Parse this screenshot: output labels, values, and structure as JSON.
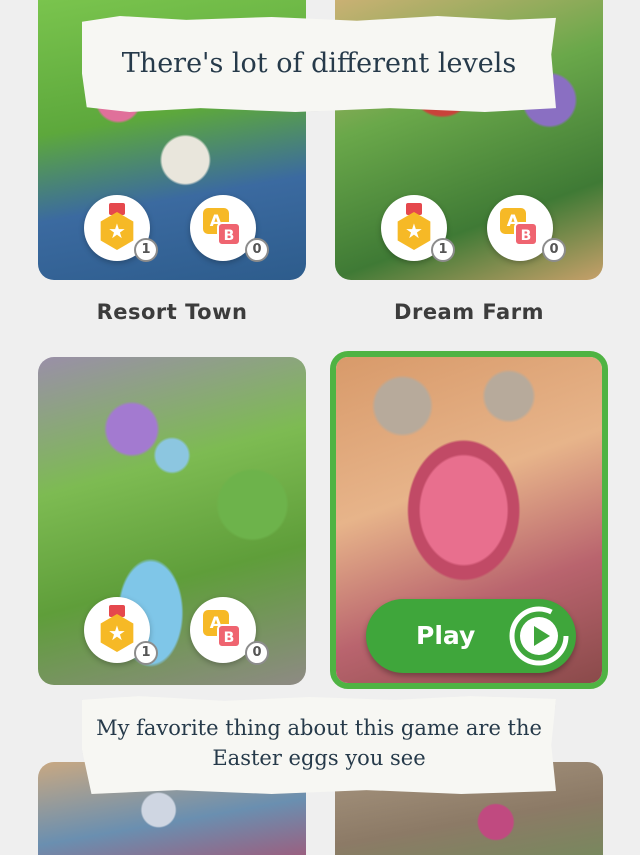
{
  "captions": {
    "top": "There's lot of different levels",
    "bottom_line1": "My favorite thing about this game are the",
    "bottom_line2": "Easter eggs you see"
  },
  "levels": [
    {
      "name": "Resort Town",
      "medal_count": "1",
      "ab_count": "0"
    },
    {
      "name": "Dream Farm",
      "medal_count": "1",
      "ab_count": "0"
    },
    {
      "name": "",
      "medal_count": "1",
      "ab_count": "0"
    },
    {
      "name": "",
      "selected": true
    },
    {
      "name": ""
    },
    {
      "name": ""
    }
  ],
  "badge_icons": {
    "medal": "medal-star-icon",
    "ab": "ab-letters-icon"
  },
  "ab_letters": {
    "a": "A",
    "b": "B"
  },
  "star_glyph": "★",
  "play_button": {
    "label": "Play",
    "icon": "play-circle-icon"
  },
  "colors": {
    "selection_border": "#4fb343",
    "play_button": "#3fa63b",
    "medal": "#f6b926",
    "ab_b": "#ef6470"
  }
}
